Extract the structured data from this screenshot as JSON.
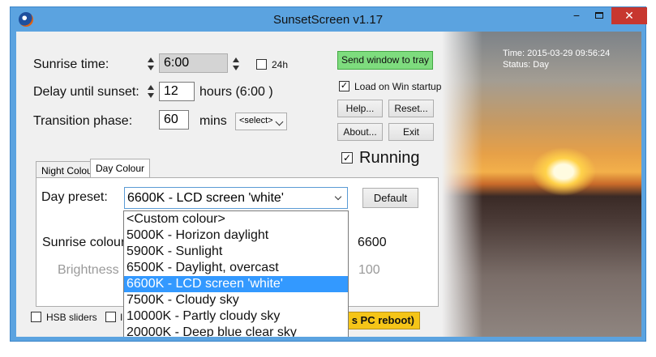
{
  "window": {
    "title": "SunsetScreen v1.17",
    "min_label": "−",
    "close_label": "✕"
  },
  "photo": {
    "time": "Time: 2015-03-29 09:56:24",
    "status": "Status: Day"
  },
  "sunrise": {
    "label": "Sunrise time:",
    "value": "6:00",
    "h24_label": "24h"
  },
  "delay": {
    "label": "Delay until sunset:",
    "value": "12",
    "unit": "hours (6:00 )"
  },
  "transition": {
    "label": "Transition phase:",
    "value": "60",
    "unit": "mins",
    "select_label": "<select>"
  },
  "buttons": {
    "tray": "Send window to tray",
    "help": "Help...",
    "reset": "Reset...",
    "about": "About...",
    "exit": "Exit",
    "default": "Default"
  },
  "startup": {
    "label": "Load on Win startup",
    "checked": "✓"
  },
  "running": {
    "label": "Running",
    "checked": "✓"
  },
  "tabs": [
    {
      "label": "Night Colour"
    },
    {
      "label": "Day Colour"
    }
  ],
  "day": {
    "preset_label": "Day preset:",
    "preset_value": "6600K - LCD screen 'white'",
    "options": [
      "<Custom colour>",
      "5000K - Horizon daylight",
      "5900K - Sunlight",
      "6500K - Daylight, overcast",
      "6600K - LCD screen 'white'",
      "7500K - Cloudy sky",
      "10000K - Partly cloudy sky",
      "20000K - Deep blue clear sky"
    ],
    "sunrise_colour_label": "Sunrise colour",
    "sunrise_colour_value": "6600",
    "brightness_label": "Brightness",
    "brightness_value": "100"
  },
  "bottom": {
    "hsb_label": "HSB sliders",
    "partial_label": "Ir",
    "reboot_tail": "s PC reboot)"
  }
}
